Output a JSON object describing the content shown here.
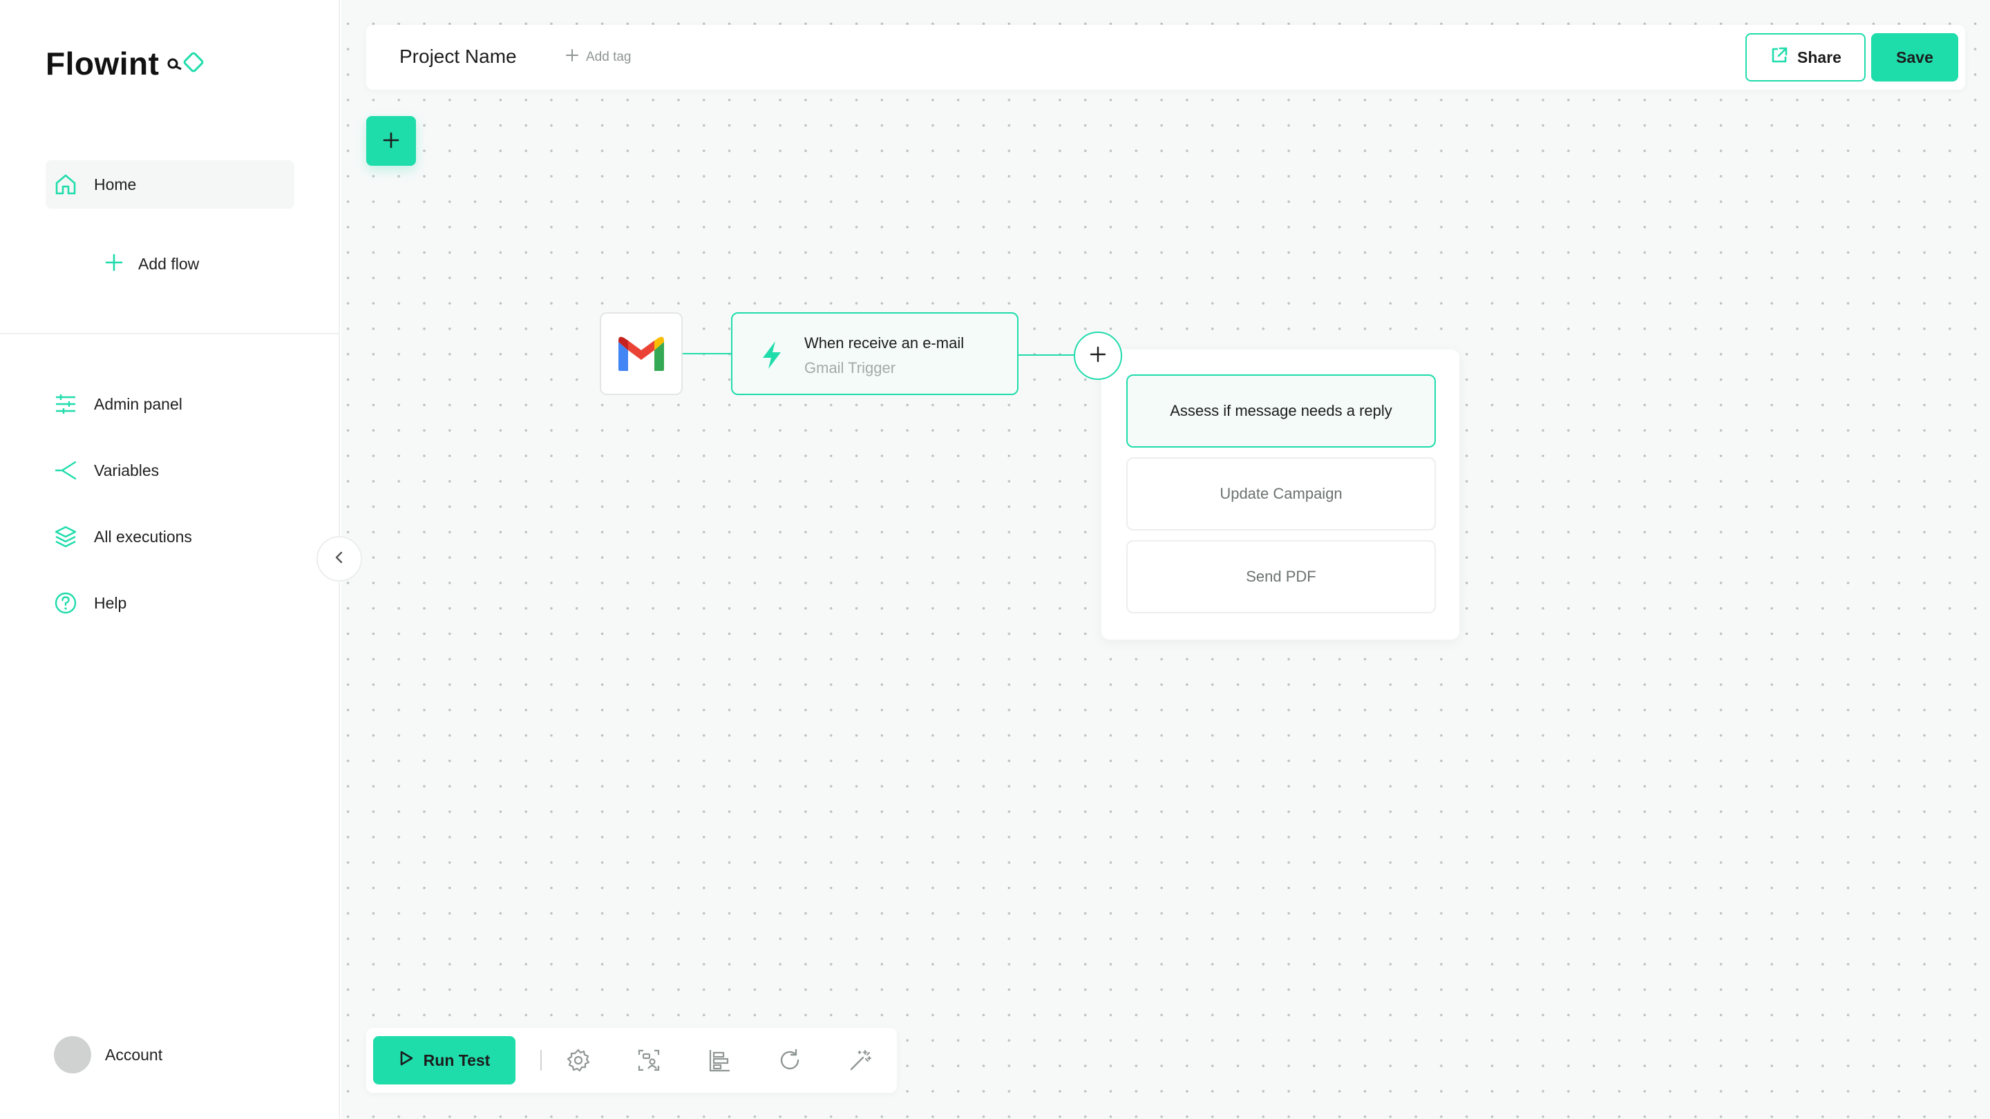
{
  "app": {
    "logo_text": "Flowint"
  },
  "sidebar": {
    "items": [
      {
        "label": "Home",
        "icon": "home-icon"
      },
      {
        "label": "Add flow",
        "icon": "plus-icon"
      },
      {
        "label": "Admin panel",
        "icon": "sliders-icon"
      },
      {
        "label": "Variables",
        "icon": "branch-icon"
      },
      {
        "label": "All  executions",
        "icon": "layers-icon"
      },
      {
        "label": "Help",
        "icon": "help-icon"
      }
    ],
    "account_label": "Account"
  },
  "header": {
    "project_name": "Project Name",
    "add_tag_label": "Add tag",
    "share_label": "Share",
    "save_label": "Save"
  },
  "flow": {
    "trigger": {
      "title": "When receive an e-mail",
      "subtitle": "Gmail Trigger"
    },
    "menu_options": [
      {
        "label": "Assess if message needs a reply",
        "selected": true
      },
      {
        "label": "Update Campaign",
        "selected": false
      },
      {
        "label": "Send PDF",
        "selected": false
      }
    ]
  },
  "toolbar": {
    "run_label": "Run Test",
    "icons": [
      "settings-icon",
      "users-icon",
      "align-icon",
      "refresh-icon",
      "magic-wand-icon"
    ]
  },
  "colors": {
    "accent": "#1fdcab",
    "canvas_bg": "#f7f9f9",
    "dot": "#b9c2c0"
  }
}
